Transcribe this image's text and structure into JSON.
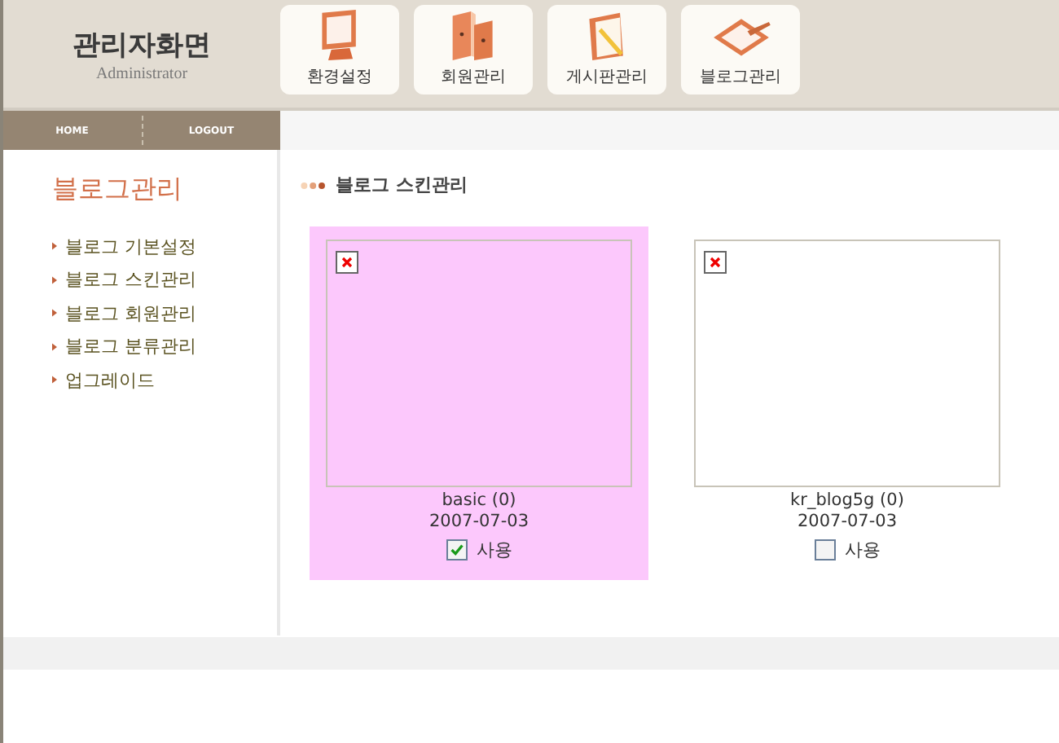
{
  "header": {
    "title": "관리자화면",
    "subtitle": "Administrator"
  },
  "nav": [
    {
      "label": "환경설정",
      "kind": "monitor"
    },
    {
      "label": "회원관리",
      "kind": "books"
    },
    {
      "label": "게시판관리",
      "kind": "notebook"
    },
    {
      "label": "블로그관리",
      "kind": "tablet"
    }
  ],
  "top_links": [
    "HOME",
    "LOGOUT"
  ],
  "sidebar": {
    "title": "블로그관리",
    "items": [
      "블로그 기본설정",
      "블로그 스킨관리",
      "블로그 회원관리",
      "블로그 분류관리",
      "업그레이드"
    ]
  },
  "section_title": "블로그 스킨관리",
  "skins": [
    {
      "name": "basic (0)",
      "date": "2007-07-03",
      "use_label": "사용",
      "checked": true,
      "selected": true
    },
    {
      "name": "kr_blog5g (0)",
      "date": "2007-07-03",
      "use_label": "사용",
      "checked": false,
      "selected": false
    }
  ]
}
